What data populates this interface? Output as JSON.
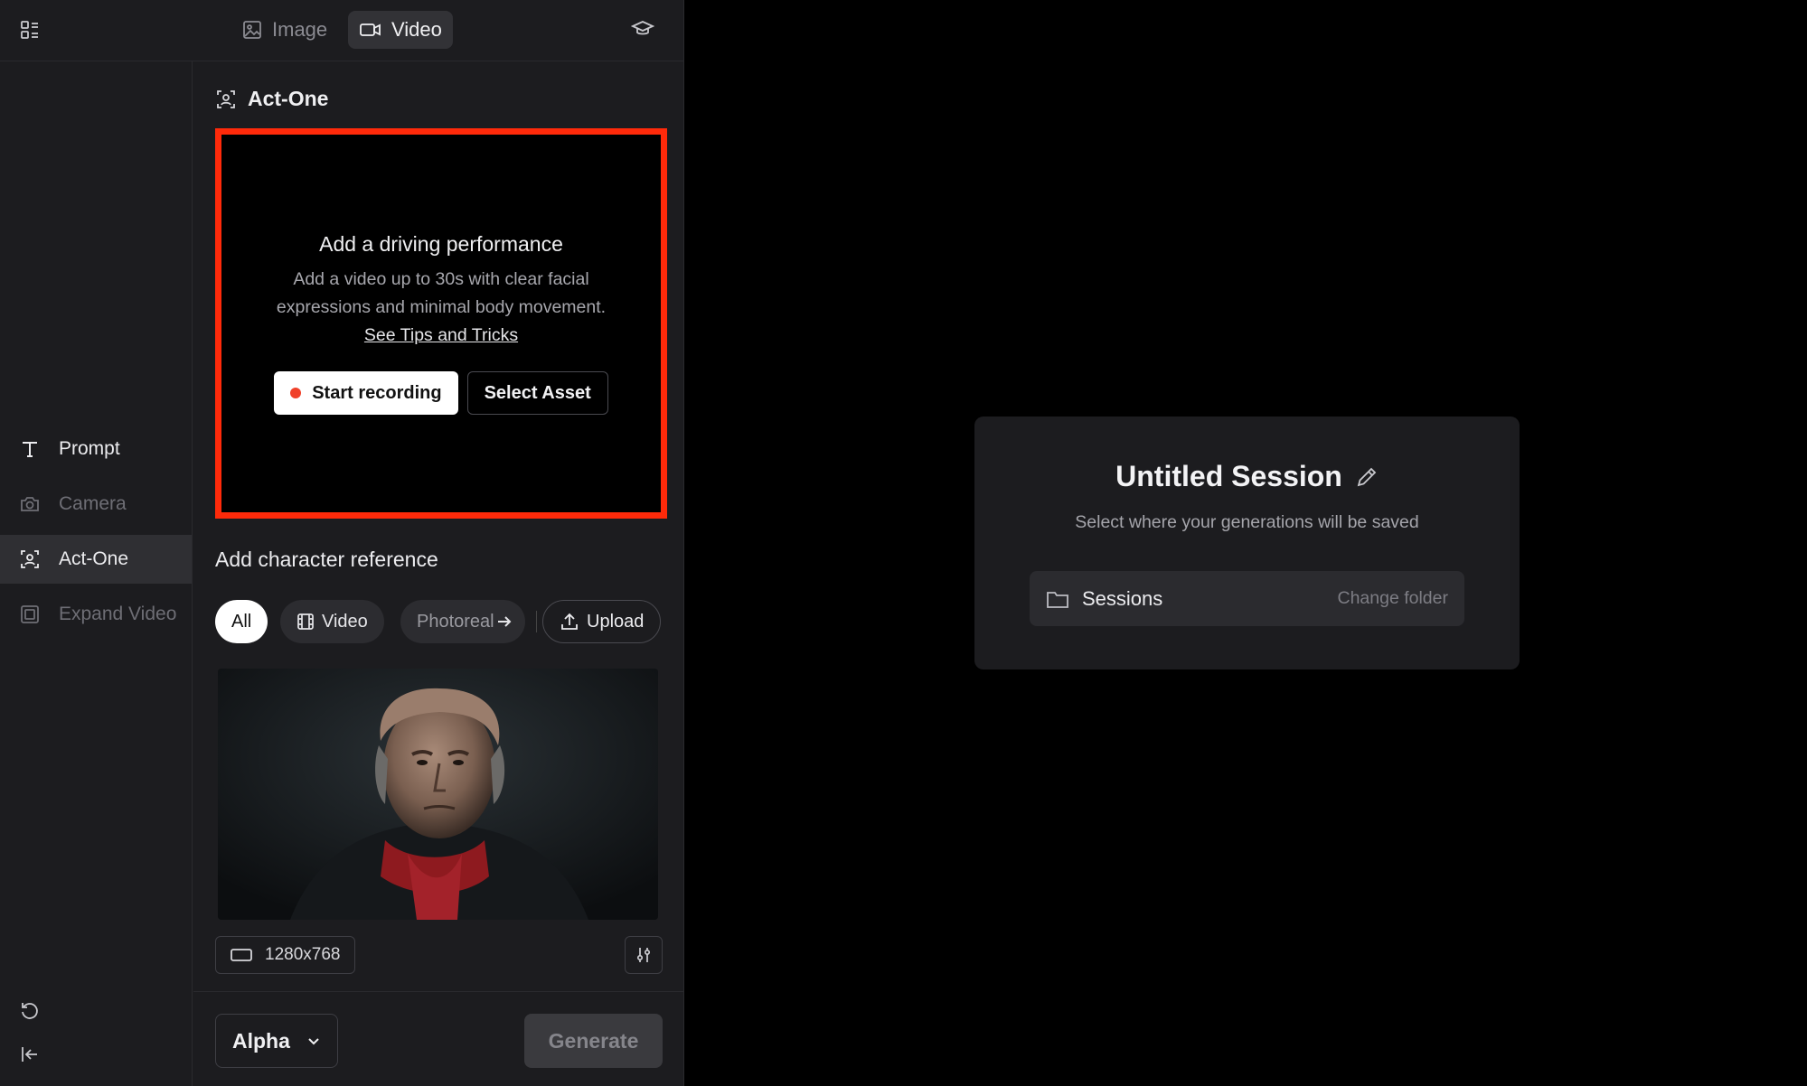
{
  "header": {
    "tabs": [
      {
        "label": "Image",
        "icon": "image-icon",
        "active": false
      },
      {
        "label": "Video",
        "icon": "video-camera-icon",
        "active": true
      }
    ]
  },
  "sidebar": {
    "items": [
      {
        "label": "Prompt",
        "icon": "text-t-icon",
        "state": "normal"
      },
      {
        "label": "Camera",
        "icon": "camera-icon",
        "state": "dim"
      },
      {
        "label": "Act-One",
        "icon": "face-scan-icon",
        "state": "selected"
      },
      {
        "label": "Expand Video",
        "icon": "expand-frame-icon",
        "state": "dim"
      }
    ]
  },
  "section": {
    "title": "Act-One"
  },
  "driving": {
    "heading": "Add a driving performance",
    "description": "Add a video up to 30s with clear facial expressions and minimal body movement.",
    "link": "See Tips and Tricks",
    "record_label": "Start recording",
    "select_label": "Select Asset"
  },
  "character": {
    "title": "Add character reference",
    "filters": {
      "all": "All",
      "video": "Video",
      "photoreal": "Photoreal",
      "upload": "Upload"
    }
  },
  "resolution": {
    "value": "1280x768"
  },
  "footer": {
    "model": "Alpha",
    "generate_label": "Generate"
  },
  "session": {
    "title": "Untitled Session",
    "subtitle": "Select where your generations will be saved",
    "folder": "Sessions",
    "change_label": "Change folder"
  },
  "colors": {
    "highlight_border": "#ff2a0a",
    "record_dot": "#f0412a",
    "panel_bg": "#1c1c1f",
    "canvas_bg": "#000000"
  }
}
